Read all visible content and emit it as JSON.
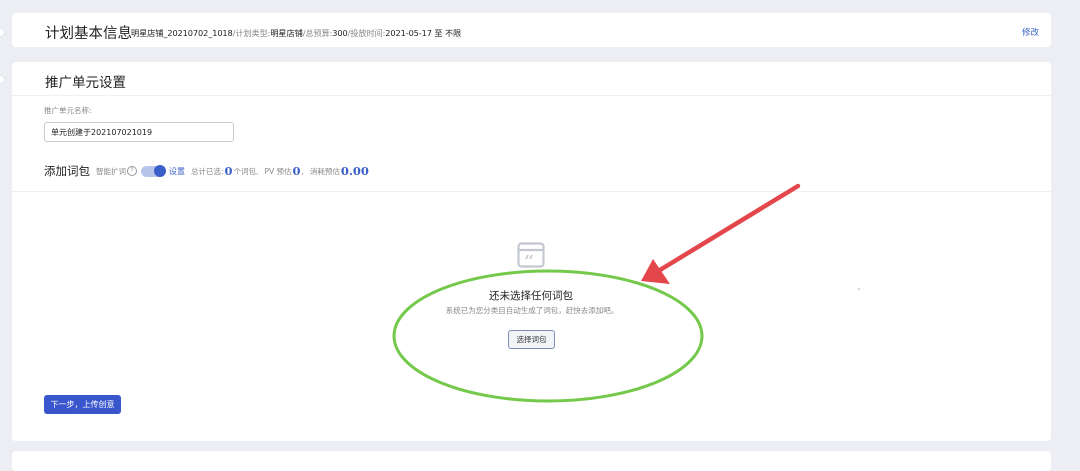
{
  "plan_info": {
    "title": "计划基本信息",
    "shop_name": "明星店铺_20210702_1018",
    "plan_type_label": "/计划类型:",
    "plan_type_value": "明星店铺",
    "budget_label": "/总预算:",
    "budget_value": "300",
    "time_label": "/投放时间:",
    "time_value": "2021-05-17 至 不限",
    "edit_label": "修改"
  },
  "unit_settings": {
    "title": "推广单元设置",
    "name_label": "推广单元名称:",
    "name_value": "单元创建于202107021019"
  },
  "add_words": {
    "title": "添加词包",
    "smart_expand_label": "智能扩词",
    "help_icon_text": "?",
    "settings_label": "设置",
    "total_selected_label": "总计已选:",
    "selected_count": "0",
    "count_unit": "个词包,",
    "pv_label": "PV 预估",
    "pv_value": "0",
    "pv_suffix": ",",
    "cost_label": "消耗预估",
    "cost_value": "0.00"
  },
  "empty_state": {
    "title": "还未选择任何词包",
    "description": "系统已为您分类目自动生成了词包，赶快去添加吧。",
    "choose_button": "选择词包",
    "icon": "empty-box-icon"
  },
  "next_button": "下一步，上传创意",
  "toggle_on": true,
  "colors": {
    "accent": "#3a56cc",
    "link": "#3a63c8",
    "annotation_arrow": "#e3474b",
    "annotation_ellipse": "#74c84a",
    "page_bg": "#eceef4"
  }
}
